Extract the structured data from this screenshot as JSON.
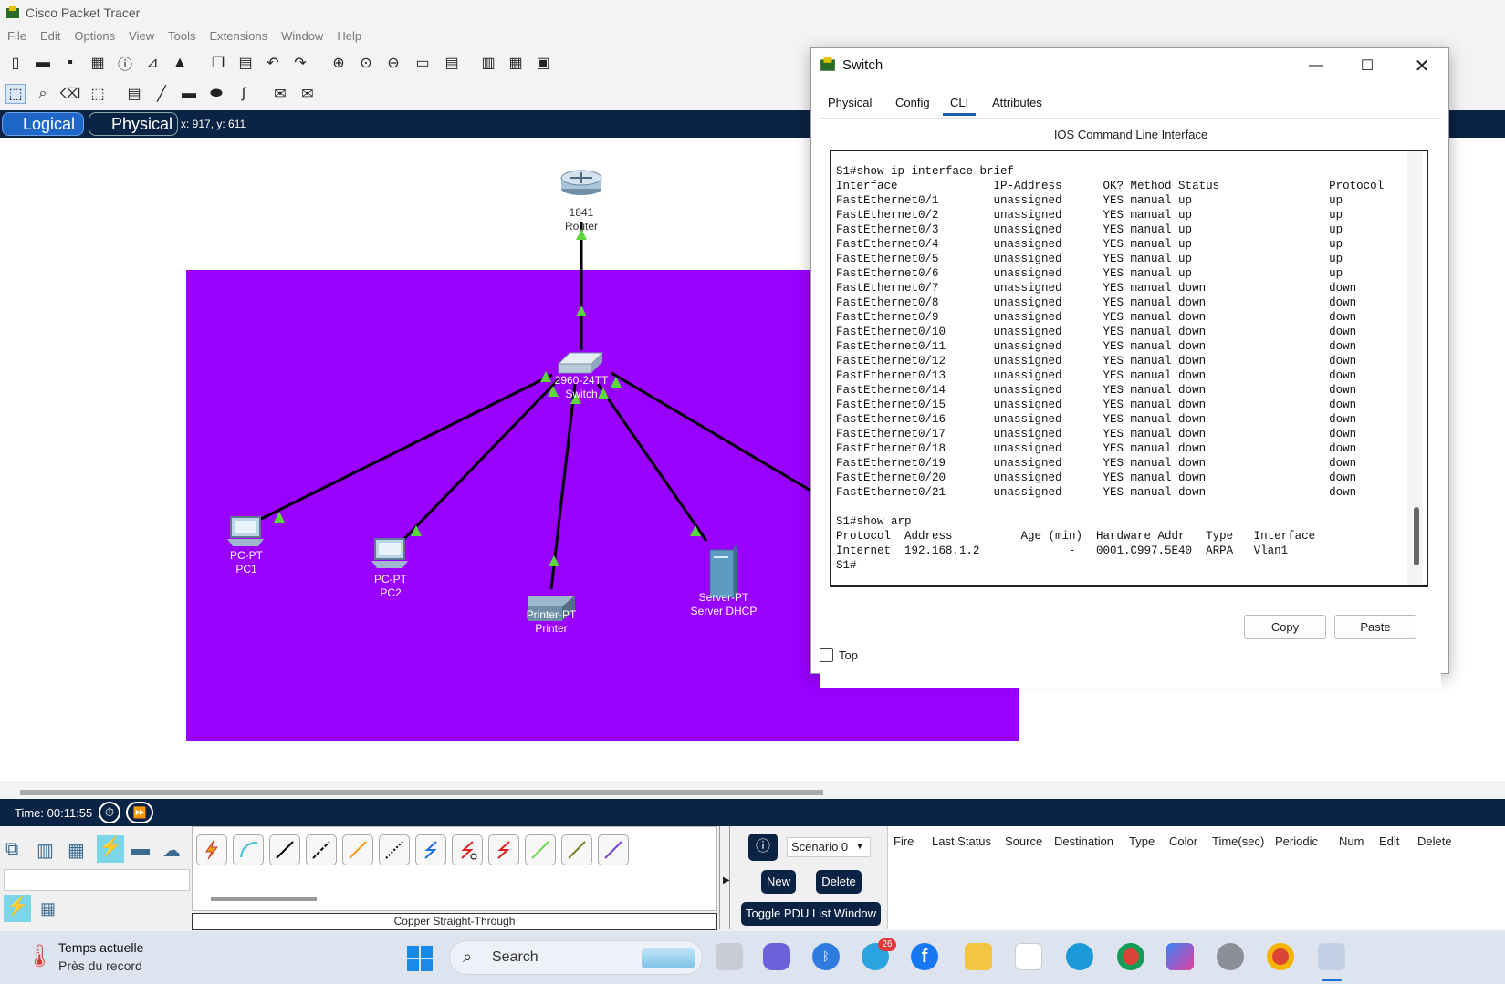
{
  "app": {
    "title": "Cisco Packet Tracer"
  },
  "menu": [
    "File",
    "Edit",
    "Options",
    "View",
    "Tools",
    "Extensions",
    "Window",
    "Help"
  ],
  "modebar": {
    "logical": "Logical",
    "physical": "Physical",
    "coords": "x: 917, y: 611"
  },
  "devices": {
    "router": {
      "model": "1841",
      "name": "Router"
    },
    "switch": {
      "model": "2960-24TT",
      "name": "Switch"
    },
    "pc1": {
      "model": "PC-PT",
      "name": "PC1"
    },
    "pc2": {
      "model": "PC-PT",
      "name": "PC2"
    },
    "printer": {
      "model": "Printer-PT",
      "name": "Printer"
    },
    "server": {
      "model": "Server-PT",
      "name": "Server DHCP"
    }
  },
  "dialog": {
    "title": "Switch",
    "tabs": [
      "Physical",
      "Config",
      "CLI",
      "Attributes"
    ],
    "active_tab": "CLI",
    "heading": "IOS Command Line Interface",
    "copy": "Copy",
    "paste": "Paste",
    "top_label": "Top",
    "terminal": "S1#show ip interface brief\nInterface              IP-Address      OK? Method Status                Protocol\nFastEthernet0/1        unassigned      YES manual up                    up\nFastEthernet0/2        unassigned      YES manual up                    up\nFastEthernet0/3        unassigned      YES manual up                    up\nFastEthernet0/4        unassigned      YES manual up                    up\nFastEthernet0/5        unassigned      YES manual up                    up\nFastEthernet0/6        unassigned      YES manual up                    up\nFastEthernet0/7        unassigned      YES manual down                  down\nFastEthernet0/8        unassigned      YES manual down                  down\nFastEthernet0/9        unassigned      YES manual down                  down\nFastEthernet0/10       unassigned      YES manual down                  down\nFastEthernet0/11       unassigned      YES manual down                  down\nFastEthernet0/12       unassigned      YES manual down                  down\nFastEthernet0/13       unassigned      YES manual down                  down\nFastEthernet0/14       unassigned      YES manual down                  down\nFastEthernet0/15       unassigned      YES manual down                  down\nFastEthernet0/16       unassigned      YES manual down                  down\nFastEthernet0/17       unassigned      YES manual down                  down\nFastEthernet0/18       unassigned      YES manual down                  down\nFastEthernet0/19       unassigned      YES manual down                  down\nFastEthernet0/20       unassigned      YES manual down                  down\nFastEthernet0/21       unassigned      YES manual down                  down\n\nS1#show arp\nProtocol  Address          Age (min)  Hardware Addr   Type   Interface\nInternet  192.168.1.2             -   0001.C997.5E40  ARPA   Vlan1\nS1#"
  },
  "timebar": {
    "time": "Time: 00:11:55"
  },
  "bottom": {
    "cable_name": "Copper Straight-Through",
    "scenario": "Scenario 0",
    "new": "New",
    "delete": "Delete",
    "toggle_pdu": "Toggle PDU List Window",
    "pdu_columns": [
      "Fire",
      "Last Status",
      "Source",
      "Destination",
      "Type",
      "Color",
      "Time(sec)",
      "Periodic",
      "Num",
      "Edit",
      "Delete"
    ]
  },
  "taskbar": {
    "weather_title": "Temps actuelle",
    "weather_sub": "Près du record",
    "search": "Search",
    "telegram_badge": "26"
  },
  "colors": {
    "workspace_area": "#9900ff",
    "modebar": "#0b2345",
    "link_ok": "#5bd63d"
  }
}
